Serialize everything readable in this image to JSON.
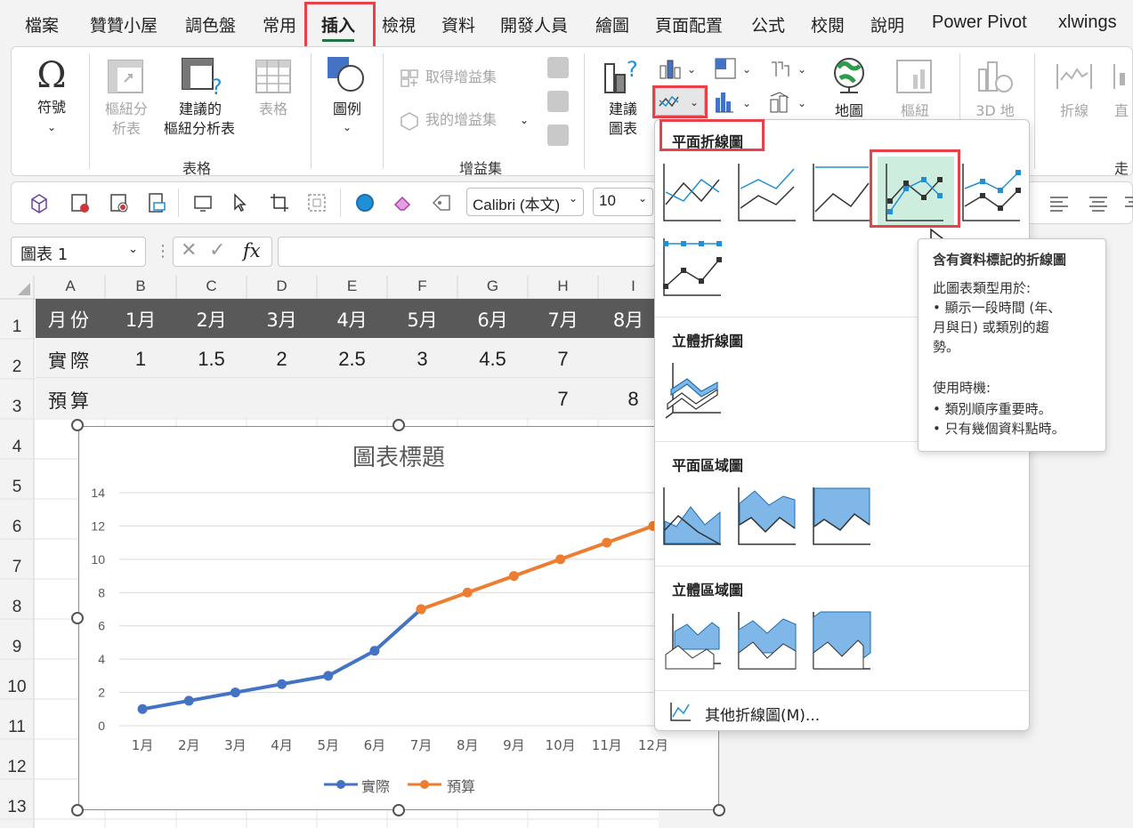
{
  "tabs": [
    "檔案",
    "贊贊小屋",
    "調色盤",
    "常用",
    "插入",
    "檢視",
    "資料",
    "開發人員",
    "繪圖",
    "頁面配置",
    "公式",
    "校閱",
    "說明",
    "Power Pivot",
    "xlwings"
  ],
  "ribbon": {
    "symbol": "符號",
    "pivot": [
      "樞紐分",
      "析表"
    ],
    "rec_pivot": [
      "建議的",
      "樞紐分析表"
    ],
    "table": "表格",
    "group_table": "表格",
    "illustration": "圖例",
    "get_addins": "取得增益集",
    "my_addins": "我的增益集",
    "group_addins": "增益集",
    "rec_chart": [
      "建議",
      "圖表"
    ],
    "map": "地圖",
    "pivotchart": "樞紐",
    "map3d": "3D 地",
    "spark_line": "折線",
    "spark_col": "直",
    "group_spark": "走勢"
  },
  "toolbar2": {
    "font": "Calibri (本文)",
    "size": "10"
  },
  "namebox": "圖表 1",
  "fx": "fx",
  "columns": [
    "A",
    "B",
    "C",
    "D",
    "E",
    "F",
    "G",
    "H",
    "I"
  ],
  "rows": [
    "1",
    "2",
    "3",
    "4",
    "5",
    "6",
    "7",
    "8",
    "9",
    "10",
    "11",
    "12",
    "13"
  ],
  "row1": [
    "月份",
    "1月",
    "2月",
    "3月",
    "4月",
    "5月",
    "6月",
    "7月",
    "8月"
  ],
  "row2": [
    "實際",
    "1",
    "1.5",
    "2",
    "2.5",
    "3",
    "4.5",
    "7",
    ""
  ],
  "row3": [
    "預算",
    "",
    "",
    "",
    "",
    "",
    "",
    "7",
    "8"
  ],
  "chart_data": {
    "type": "line",
    "title": "圖表標題",
    "categories": [
      "1月",
      "2月",
      "3月",
      "4月",
      "5月",
      "6月",
      "7月",
      "8月",
      "9月",
      "10月",
      "11月",
      "12月"
    ],
    "ylim": [
      0,
      14
    ],
    "yticks": [
      "0",
      "2",
      "4",
      "6",
      "8",
      "10",
      "12",
      "14"
    ],
    "series": [
      {
        "name": "實際",
        "color": "#4472c4",
        "values": [
          1,
          1.5,
          2,
          2.5,
          3,
          4.5,
          7,
          null,
          null,
          null,
          null,
          null
        ]
      },
      {
        "name": "預算",
        "color": "#ed7d31",
        "values": [
          null,
          null,
          null,
          null,
          null,
          null,
          7,
          8,
          9,
          10,
          11,
          12
        ]
      }
    ],
    "legend": "bottom"
  },
  "dropdown": {
    "sec1": "平面折線圖",
    "sec2": "立體折線圖",
    "sec3": "平面區域圖",
    "sec4": "立體區域圖",
    "more": "其他折線圖(M)..."
  },
  "tooltip": {
    "title": "含有資料標記的折線圖",
    "l1": "此圖表類型用於:",
    "l2": "• 顯示一段時間 (年、",
    "l3": "月與日) 或類別的趨",
    "l4": "勢。",
    "l5": "使用時機:",
    "l6": "• 類別順序重要時。",
    "l7": "• 只有幾個資料點時。"
  },
  "colors": {
    "accent": "#217346",
    "highlight": "#e8414a",
    "blue": "#4472c4",
    "orange": "#ed7d31",
    "header": "#595959",
    "chart_blue": "#1f8fd6"
  }
}
